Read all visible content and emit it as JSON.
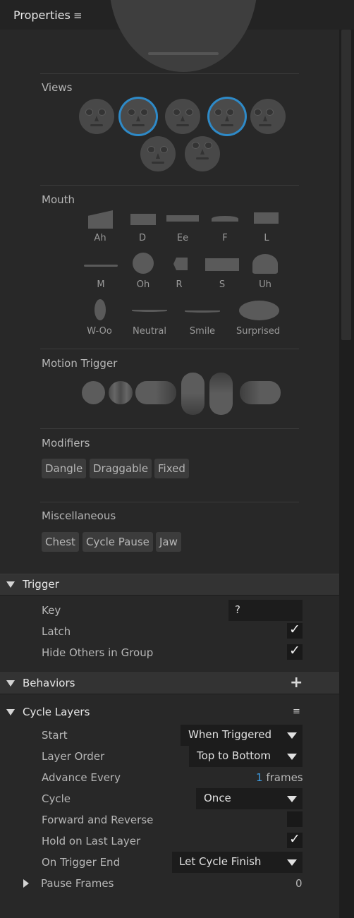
{
  "panel": {
    "title": "Properties",
    "menu_icon": "hamburger-icon"
  },
  "sections": {
    "views": "Views",
    "mouth": "Mouth",
    "motion_trigger": "Motion Trigger",
    "modifiers": "Modifiers",
    "miscellaneous": "Miscellaneous"
  },
  "mouth_shapes": [
    "Ah",
    "D",
    "Ee",
    "F",
    "L",
    "M",
    "Oh",
    "R",
    "S",
    "Uh",
    "W-Oo",
    "Neutral",
    "Smile",
    "Surprised"
  ],
  "modifiers": [
    "Dangle",
    "Draggable",
    "Fixed"
  ],
  "miscellaneous": [
    "Chest",
    "Cycle Pause",
    "Jaw"
  ],
  "trigger": {
    "title": "Trigger",
    "key_label": "Key",
    "key_value": "?",
    "latch_label": "Latch",
    "latch_checked": true,
    "hide_others_label": "Hide Others in Group",
    "hide_others_checked": true
  },
  "behaviors": {
    "title": "Behaviors",
    "add_icon": "plus-icon"
  },
  "cycle_layers": {
    "title": "Cycle Layers",
    "start_label": "Start",
    "start_value": "When Triggered",
    "layer_order_label": "Layer Order",
    "layer_order_value": "Top to Bottom",
    "advance_every_label": "Advance Every",
    "advance_every_value": "1",
    "advance_every_unit": "frames",
    "cycle_label": "Cycle",
    "cycle_value": "Once",
    "forward_reverse_label": "Forward and Reverse",
    "forward_reverse_checked": false,
    "hold_last_label": "Hold on Last Layer",
    "hold_last_checked": true,
    "on_trigger_end_label": "On Trigger End",
    "on_trigger_end_value": "Let Cycle Finish",
    "pause_frames_label": "Pause Frames",
    "pause_frames_value": "0"
  },
  "colors": {
    "accent": "#2e8ac8",
    "value_link": "#3d9be0"
  }
}
